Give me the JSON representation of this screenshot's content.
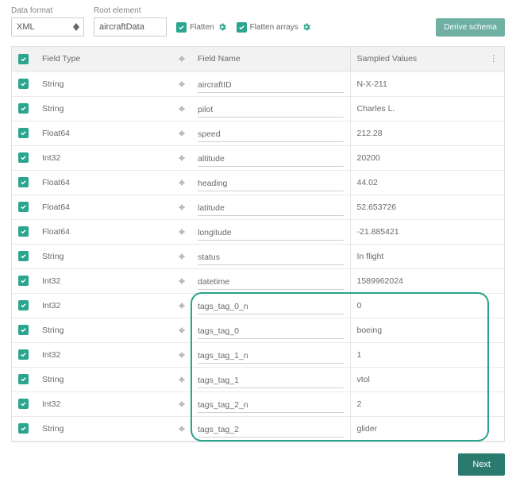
{
  "top": {
    "data_format_label": "Data format",
    "data_format_value": "XML",
    "root_element_label": "Root element",
    "root_element_value": "aircraftData",
    "flatten_label": "Flatten",
    "flatten_arrays_label": "Flatten arrays",
    "derive_schema_label": "Derive schema"
  },
  "headers": {
    "field_type": "Field Type",
    "field_name": "Field Name",
    "sampled_values": "Sampled Values"
  },
  "rows": [
    {
      "type": "String",
      "name": "aircraftID",
      "value": "N-X-211"
    },
    {
      "type": "String",
      "name": "pilot",
      "value": "Charles L."
    },
    {
      "type": "Float64",
      "name": "speed",
      "value": "212.28"
    },
    {
      "type": "Int32",
      "name": "altitude",
      "value": "20200"
    },
    {
      "type": "Float64",
      "name": "heading",
      "value": "44.02"
    },
    {
      "type": "Float64",
      "name": "latitude",
      "value": "52.653726"
    },
    {
      "type": "Float64",
      "name": "longitude",
      "value": "-21.885421"
    },
    {
      "type": "String",
      "name": "status",
      "value": "In flight"
    },
    {
      "type": "Int32",
      "name": "datetime",
      "value": "1589962024"
    },
    {
      "type": "Int32",
      "name": "tags_tag_0_n",
      "value": "0"
    },
    {
      "type": "String",
      "name": "tags_tag_0",
      "value": "boeing"
    },
    {
      "type": "Int32",
      "name": "tags_tag_1_n",
      "value": "1"
    },
    {
      "type": "String",
      "name": "tags_tag_1",
      "value": "vtol"
    },
    {
      "type": "Int32",
      "name": "tags_tag_2_n",
      "value": "2"
    },
    {
      "type": "String",
      "name": "tags_tag_2",
      "value": "glider"
    }
  ],
  "footer": {
    "next_label": "Next"
  }
}
